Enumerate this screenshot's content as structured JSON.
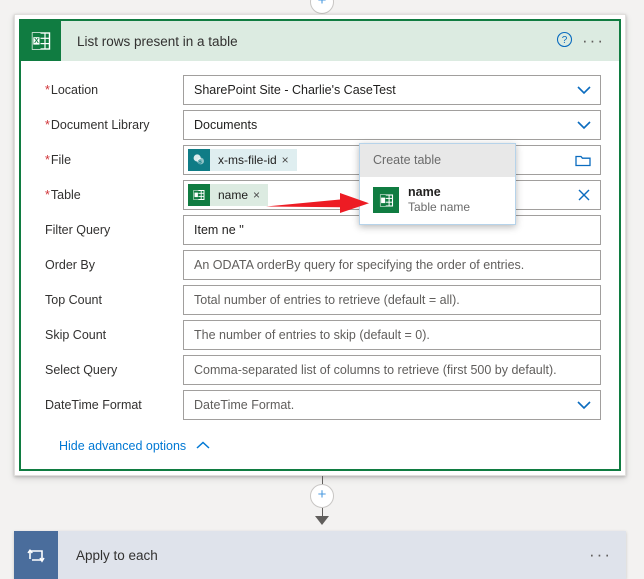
{
  "top_connector": {
    "plus_label": "+"
  },
  "action_card": {
    "icon": "excel-icon",
    "title": "List rows present in a table",
    "help_label": "?",
    "more_label": "···",
    "fields": [
      {
        "label": "Location",
        "required": true,
        "type": "dropdown",
        "value": "SharePoint Site - Charlie's CaseTest",
        "placeholder": "",
        "trailing_icon": "chevron-down-icon"
      },
      {
        "label": "Document Library",
        "required": true,
        "type": "dropdown",
        "value": "Documents",
        "placeholder": "",
        "trailing_icon": "chevron-down-icon"
      },
      {
        "label": "File",
        "required": true,
        "type": "token",
        "token_label": "x-ms-file-id",
        "token_icon": "sharepoint-icon",
        "token_remove": "×",
        "trailing_icon": "folder-picker-icon"
      },
      {
        "label": "Table",
        "required": true,
        "type": "token",
        "token_label": "name",
        "token_icon": "excel-icon",
        "token_remove": "×",
        "trailing_icon": "clear-icon"
      },
      {
        "label": "Filter Query",
        "required": false,
        "type": "text",
        "value": "Item ne ''",
        "placeholder": ""
      },
      {
        "label": "Order By",
        "required": false,
        "type": "text",
        "value": "",
        "placeholder": "An ODATA orderBy query for specifying the order of entries."
      },
      {
        "label": "Top Count",
        "required": false,
        "type": "text",
        "value": "",
        "placeholder": "Total number of entries to retrieve (default = all)."
      },
      {
        "label": "Skip Count",
        "required": false,
        "type": "text",
        "value": "",
        "placeholder": "The number of entries to skip (default = 0)."
      },
      {
        "label": "Select Query",
        "required": false,
        "type": "text",
        "value": "",
        "placeholder": "Comma-separated list of columns to retrieve (first 500 by default)."
      },
      {
        "label": "DateTime Format",
        "required": false,
        "type": "dropdown",
        "value": "",
        "placeholder": "DateTime Format.",
        "trailing_icon": "chevron-down-icon"
      }
    ],
    "advanced_link": "Hide advanced options",
    "advanced_caret": "chevron-up-icon"
  },
  "create_table_popup": {
    "header": "Create table",
    "item_name": "name",
    "item_subtitle": "Table name",
    "item_icon": "excel-icon"
  },
  "annotation": {
    "type": "red-arrow",
    "color": "#ed1c24",
    "points_to": "create-table-popup"
  },
  "bottom_connector": {
    "plus_label": "+"
  },
  "apply_card": {
    "icon": "loop-icon",
    "title": "Apply to each",
    "more_label": "···"
  },
  "colors": {
    "excel_green": "#107c41",
    "header_green_bg": "#dcebe1",
    "accent_blue": "#0078d4",
    "required_red": "#d13438",
    "annotation_red": "#ed1c24",
    "loop_blue": "#4a6d9c",
    "apply_bg": "#dfe3eb",
    "page_bg": "#f3f2f1"
  }
}
